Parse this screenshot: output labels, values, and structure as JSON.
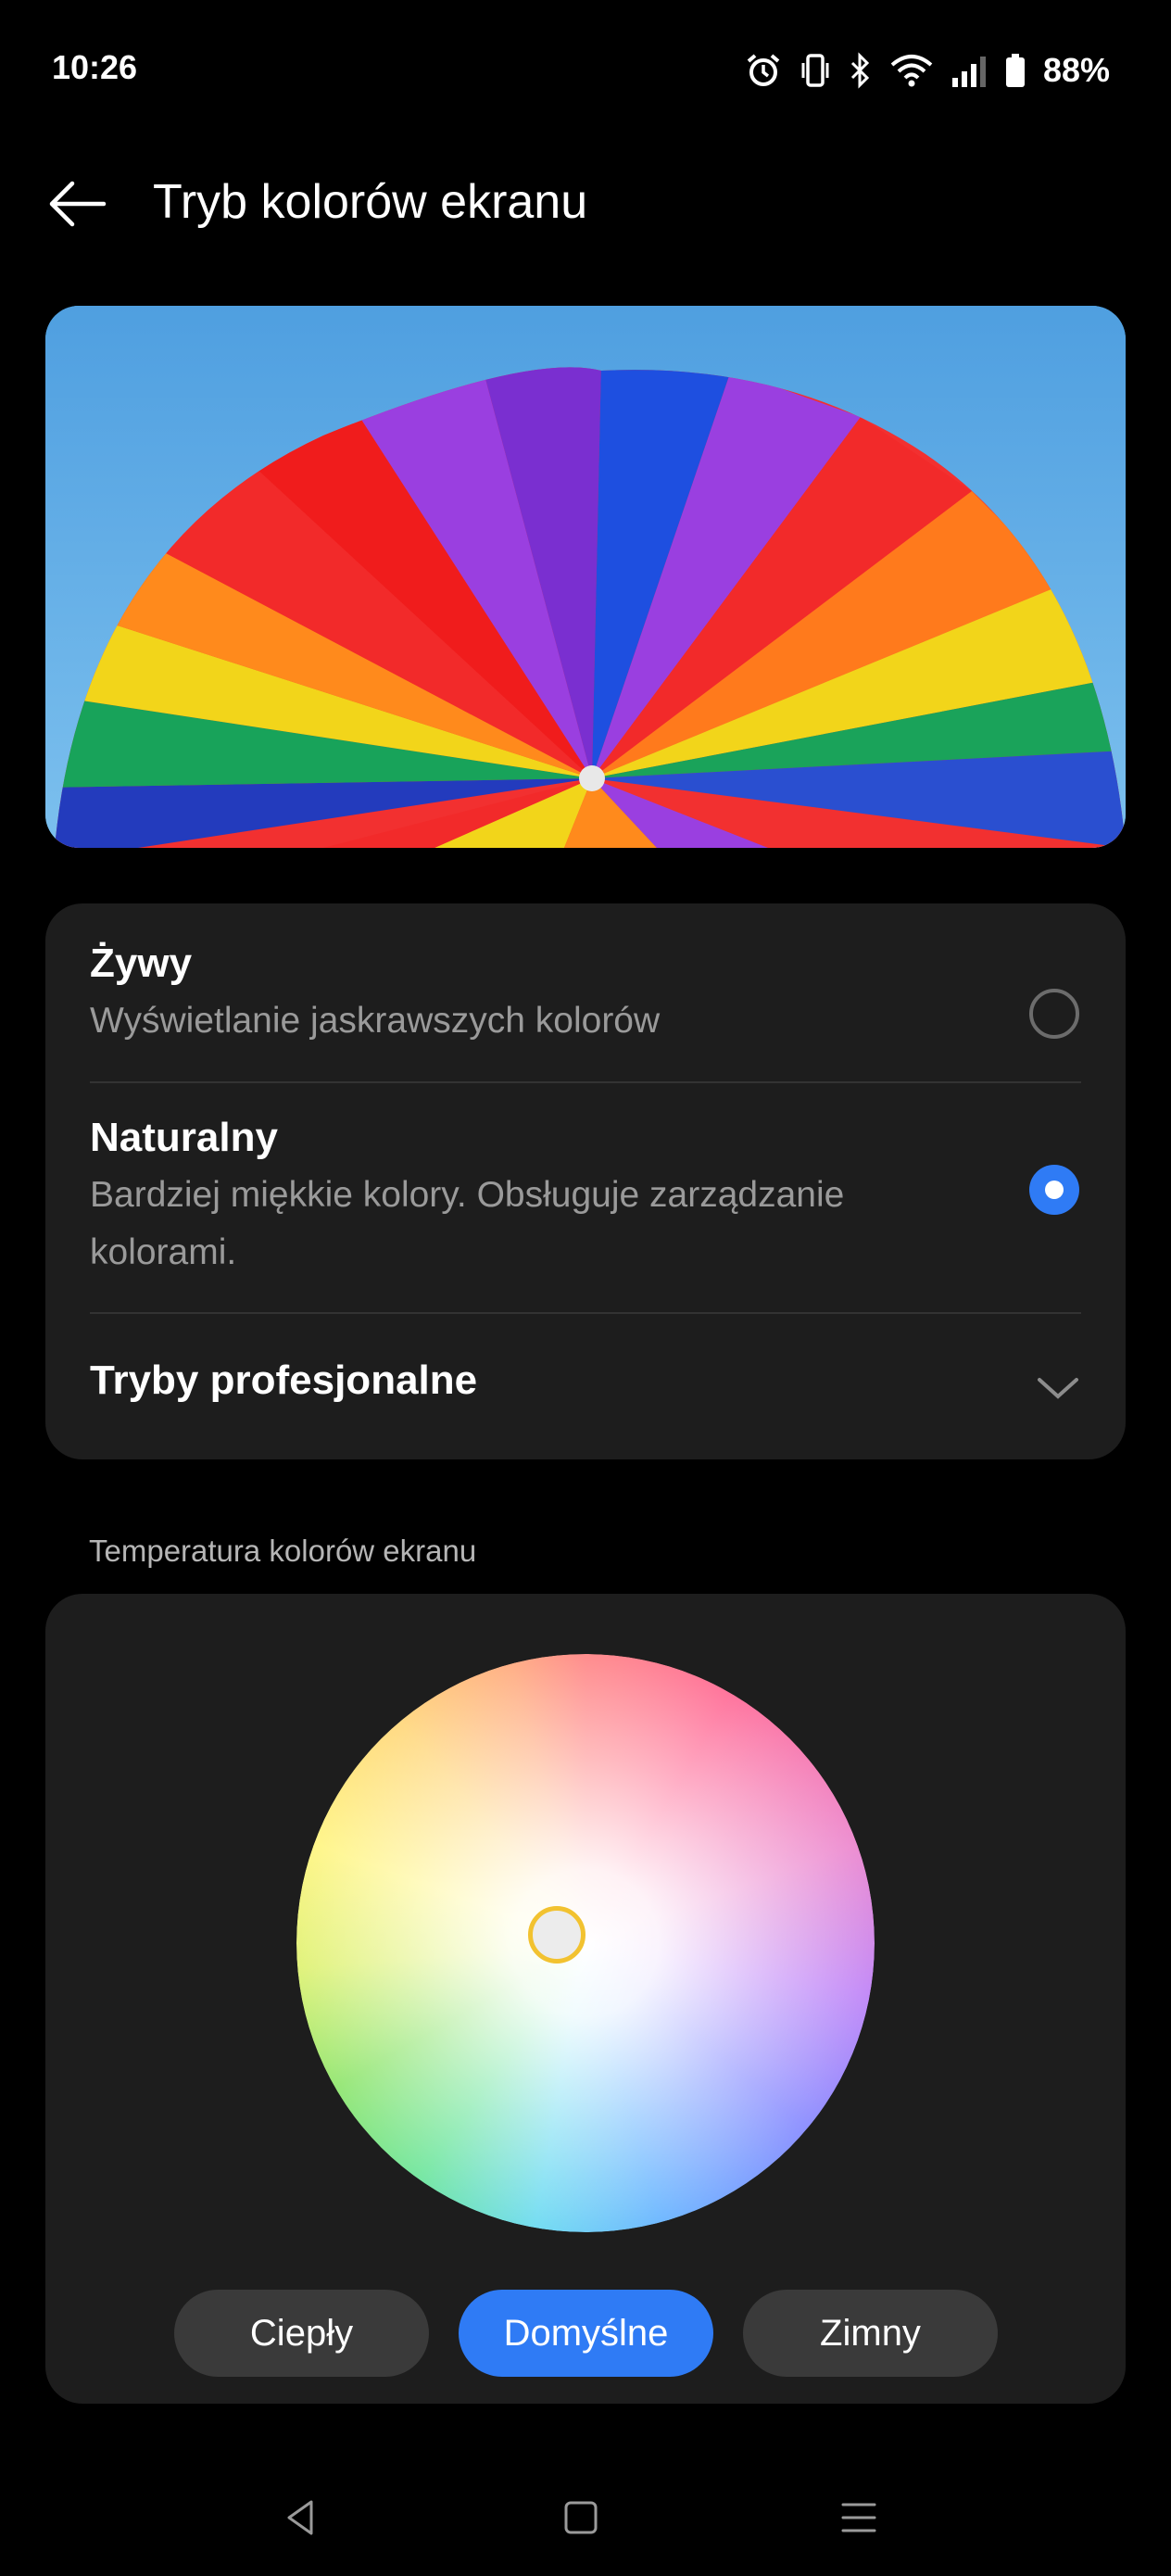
{
  "status_bar": {
    "time": "10:26",
    "battery": "88%",
    "icons": [
      "alarm-icon",
      "vibrate-icon",
      "bluetooth-icon",
      "wifi-icon",
      "signal-icon",
      "battery-icon"
    ]
  },
  "header": {
    "title": "Tryb kolorów ekranu",
    "back_icon": "arrow-left-icon"
  },
  "modes": [
    {
      "title": "Żywy",
      "subtitle": "Wyświetlanie jaskrawszych kolorów",
      "selected": false
    },
    {
      "title": "Naturalny",
      "subtitle": "Bardziej miękkie kolory. Obsługuje zarządzanie kolorami.",
      "selected": true
    }
  ],
  "professional": {
    "label": "Tryby profesjonalne",
    "icon": "chevron-down-icon"
  },
  "temperature": {
    "section_label": "Temperatura kolorów ekranu",
    "buttons": [
      {
        "label": "Ciepły",
        "active": false
      },
      {
        "label": "Domyślne",
        "active": true
      },
      {
        "label": "Zimny",
        "active": false
      }
    ]
  },
  "nav_bar": {
    "icons": [
      "back-triangle-icon",
      "home-square-icon",
      "menu-lines-icon"
    ]
  },
  "colors": {
    "accent": "#2f7bf5",
    "card": "#1d1d1d",
    "handle": "#f2c230"
  }
}
